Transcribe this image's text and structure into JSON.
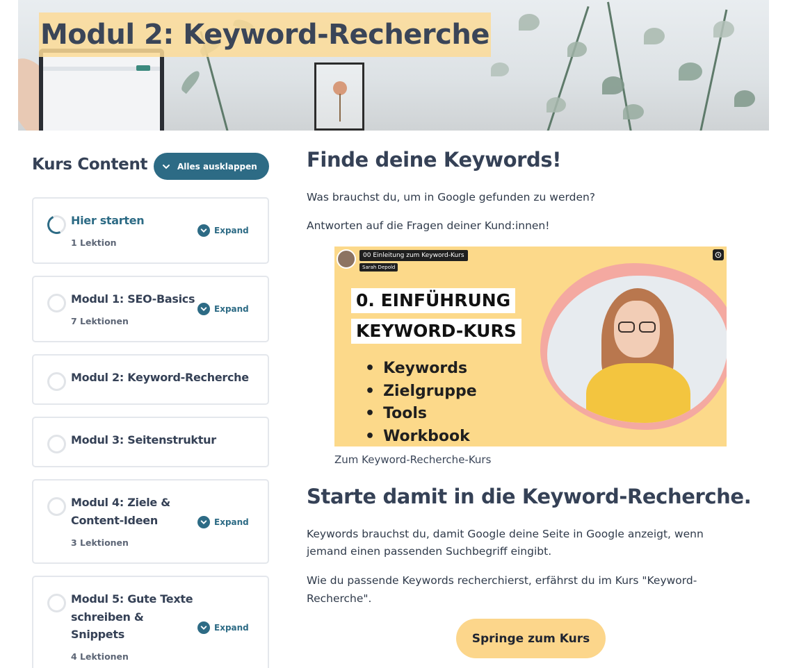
{
  "hero": {
    "title": "Modul 2: Keyword-Recherche"
  },
  "sidebar": {
    "heading": "Kurs Content",
    "expand_all_label": "Alles ausklappen",
    "expand_label": "Expand",
    "items": [
      {
        "title": "Hier starten",
        "lessons": "1 Lektion",
        "has_expand": true,
        "active": true
      },
      {
        "title": "Modul 1: SEO-Basics",
        "lessons": "7 Lektionen",
        "has_expand": true,
        "active": false
      },
      {
        "title": "Modul 2: Keyword-Recherche",
        "lessons": "",
        "has_expand": false,
        "active": false
      },
      {
        "title": "Modul 3: Seitenstruktur",
        "lessons": "",
        "has_expand": false,
        "active": false
      },
      {
        "title_line1": "Modul 4: Ziele &",
        "title_line2": "Content-Ideen",
        "lessons": "3 Lektionen",
        "has_expand": true,
        "active": false
      },
      {
        "title_line1": "Modul 5: Gute Texte",
        "title_line2": "schreiben &",
        "title_line3": "Snippets",
        "lessons": "4 Lektionen",
        "has_expand": true,
        "active": false
      }
    ]
  },
  "main": {
    "heading1": "Finde deine Keywords!",
    "p1": "Was brauchst du, um in Google gefunden zu werden?",
    "p2": "Antworten auf die Fragen deiner Kund:innen!",
    "video": {
      "title": "00 Einleitung zum Keyword-Kurs",
      "author": "Sarah Depold",
      "label1": "0. EINFÜHRUNG",
      "label2": "KEYWORD-KURS",
      "bullets": [
        "Keywords",
        "Zielgruppe",
        "Tools",
        "Workbook"
      ]
    },
    "caption": "Zum Keyword-Recherche-Kurs",
    "heading2": "Starte damit in die Keyword-Recherche.",
    "p3_line1": "Keywords brauchst du, damit Google deine Seite in Google anzeigt, wenn",
    "p3_line2": "jemand einen passenden Suchbegriff eingibt.",
    "p4_line1": "Wie du passende Keywords recherchierst, erfährst du im Kurs \"Keyword-",
    "p4_line2": "Recherche\".",
    "cta_label": "Springe zum Kurs"
  },
  "colors": {
    "accent": "#2d6b85",
    "highlight": "#fcd68b",
    "text": "#354156"
  }
}
